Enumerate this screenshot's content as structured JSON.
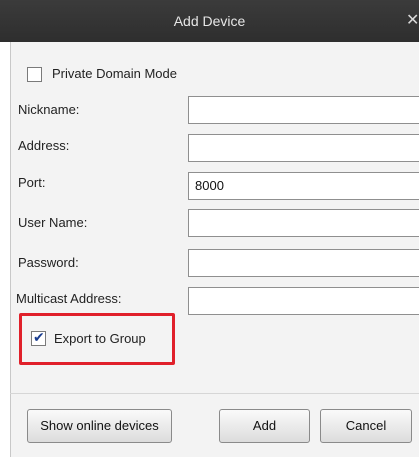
{
  "window": {
    "title": "Add Device",
    "close_glyph": "✕"
  },
  "form": {
    "private_domain": {
      "label": "Private Domain Mode",
      "checked": false
    },
    "nickname": {
      "label": "Nickname:",
      "value": ""
    },
    "address": {
      "label": "Address:",
      "value": ""
    },
    "port": {
      "label": "Port:",
      "value": "8000"
    },
    "username": {
      "label": "User Name:",
      "value": ""
    },
    "password": {
      "label": "Password:",
      "value": ""
    },
    "multicast": {
      "label": "Multicast Address:",
      "value": ""
    },
    "export_group": {
      "label": "Export to Group",
      "checked": true,
      "check_glyph": "✔"
    }
  },
  "buttons": {
    "show_online": "Show online devices",
    "add": "Add",
    "cancel": "Cancel"
  },
  "colors": {
    "highlight": "#e0202a",
    "titlebar": "#333333",
    "panel": "#f3f3f3"
  }
}
